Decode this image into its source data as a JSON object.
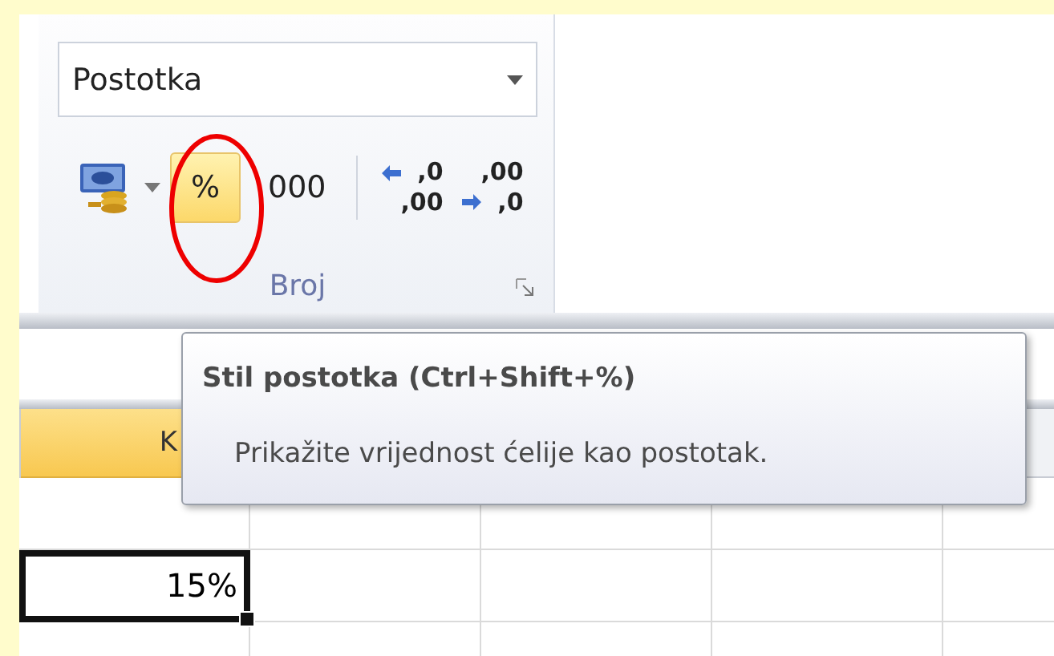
{
  "ribbon_group": {
    "label": "Broj",
    "format_dropdown": {
      "value": "Postotka"
    },
    "buttons": [
      {
        "kind": "currency",
        "selected": false
      },
      {
        "kind": "percent",
        "label": "%",
        "selected": true
      },
      {
        "kind": "comma",
        "label": "000",
        "selected": false
      },
      {
        "kind": "separator"
      },
      {
        "kind": "decimal-increase",
        "top": ",0",
        "bottom": ",00",
        "selected": false
      },
      {
        "kind": "decimal-decrease",
        "top": ",00",
        "bottom": ",0",
        "selected": false
      }
    ]
  },
  "sheet": {
    "column_header": {
      "label": "K",
      "selected": true
    },
    "active_cell": {
      "value": "15%"
    }
  },
  "tooltip": {
    "title": "Stil postotka (Ctrl+Shift+%)",
    "description": "Prikažite vrijednost ćelije kao postotak."
  }
}
